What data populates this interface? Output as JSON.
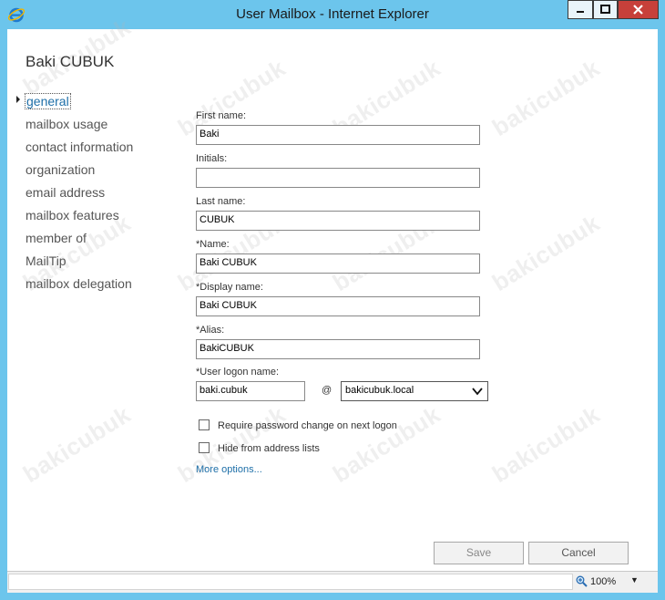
{
  "window": {
    "title": "User Mailbox - Internet Explorer",
    "controls": {
      "minimize": "minimize-icon",
      "maximize": "maximize-icon",
      "close": "close-icon"
    }
  },
  "user_name": "Baki CUBUK",
  "nav": {
    "items": [
      {
        "label": "general",
        "active": true
      },
      {
        "label": "mailbox usage"
      },
      {
        "label": "contact information"
      },
      {
        "label": "organization"
      },
      {
        "label": "email address"
      },
      {
        "label": "mailbox features"
      },
      {
        "label": "member of"
      },
      {
        "label": "MailTip"
      },
      {
        "label": "mailbox delegation"
      }
    ]
  },
  "form": {
    "first_name": {
      "label": "First name:",
      "value": "Baki"
    },
    "initials": {
      "label": "Initials:",
      "value": ""
    },
    "last_name": {
      "label": "Last name:",
      "value": "CUBUK"
    },
    "name": {
      "label": "*Name:",
      "value": "Baki CUBUK"
    },
    "display_name": {
      "label": "*Display name:",
      "value": "Baki CUBUK"
    },
    "alias": {
      "label": "*Alias:",
      "value": "BakiCUBUK"
    },
    "logon": {
      "label": "*User logon name:",
      "value": "baki.cubuk",
      "at": "@",
      "domain": "bakicubuk.local"
    },
    "require_pw_change": {
      "label": "Require password change on next logon",
      "checked": false
    },
    "hide_address": {
      "label": "Hide from address lists",
      "checked": false
    },
    "more_options": "More options..."
  },
  "buttons": {
    "save": "Save",
    "cancel": "Cancel"
  },
  "status": {
    "zoom": "100%"
  },
  "watermark": "bakicubuk",
  "colors": {
    "frame": "#6cc5ec",
    "accent": "#1e6fa8",
    "close": "#c7403a"
  }
}
